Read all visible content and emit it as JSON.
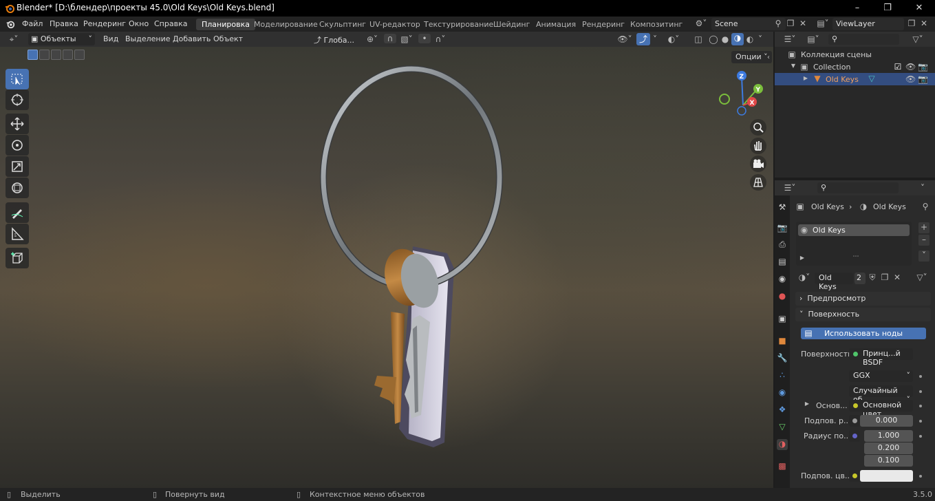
{
  "window": {
    "title": "Blender* [D:\\блендер\\проекты 45.0\\Old Keys\\Old Keys.blend]"
  },
  "menu": [
    "Файл",
    "Правка",
    "Рендеринг",
    "Окно",
    "Справка"
  ],
  "workspaces": [
    "Планировка",
    "Моделирование",
    "Скульптинг",
    "UV-редактор",
    "Текстурирование",
    "Шейдинг",
    "Анимация",
    "Рендеринг",
    "Композитинг"
  ],
  "scene": {
    "name": "Scene",
    "view_layer": "ViewLayer"
  },
  "viewport_header": {
    "mode": "Объекты",
    "menus": [
      "Вид",
      "Выделение",
      "Добавить",
      "Объект"
    ],
    "orientation": "Глоба...",
    "options": "Опции"
  },
  "outliner": {
    "scene_collection": "Коллекция сцены",
    "collection": "Collection",
    "object": "Old Keys"
  },
  "properties": {
    "breadcrumb": [
      "Old Keys",
      "Old Keys"
    ],
    "slot": "Old Keys",
    "material": {
      "name": "Old Keys",
      "users": "2"
    },
    "preview_panel": "Предпросмотр",
    "surface_panel": "Поверхность",
    "use_nodes": "Использовать ноды",
    "surface_label": "Поверхность",
    "surface_value": "Принц...й BSDF",
    "distribution": "GGX",
    "subsurface_method": "Случайный об...",
    "base_label": "Основ...",
    "base_value": "Основной цвет",
    "subsurface_label": "Подпов. р...",
    "subsurface_value": "0.000",
    "radius_label": "Радиус по...",
    "radius_values": [
      "1.000",
      "0.200",
      "0.100"
    ],
    "subsurface_color_label": "Подпов. цв...",
    "subsurface_color": "#e9e9e9"
  },
  "statusbar": {
    "select": "Выделить",
    "rotate": "Повернуть вид",
    "context": "Контекстное меню объектов",
    "version": "3.5.0"
  },
  "colors": {
    "accent": "#4772b3",
    "selection": "#334d80",
    "object_orange": "#e0883c"
  }
}
